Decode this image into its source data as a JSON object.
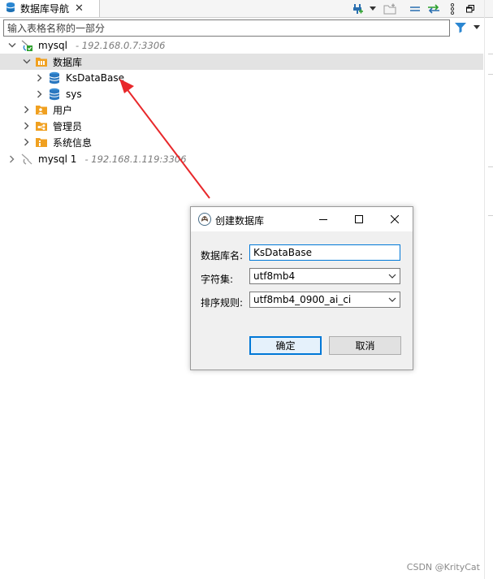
{
  "tab": {
    "title": "数据库导航"
  },
  "filter": {
    "placeholder": "输入表格名称的一部分"
  },
  "tree": {
    "conn1": {
      "name": "mysql",
      "host": "- 192.168.0.7:3306"
    },
    "databases": {
      "label": "数据库"
    },
    "db1": {
      "label": "KsDataBase"
    },
    "db2": {
      "label": "sys"
    },
    "users": {
      "label": "用户"
    },
    "admins": {
      "label": "管理员"
    },
    "sysinfo": {
      "label": "系统信息"
    },
    "conn2": {
      "name": "mysql 1",
      "host": "- 192.168.1.119:3306"
    }
  },
  "dialog": {
    "title": "创建数据库",
    "name_label": "数据库名:",
    "name_value": "KsDataBase",
    "charset_label": "字符集:",
    "charset_value": "utf8mb4",
    "collation_label": "排序规则:",
    "collation_value": "utf8mb4_0900_ai_ci",
    "ok_label": "确定",
    "cancel_label": "取消"
  },
  "watermark": "CSDN @KrityCat",
  "colors": {
    "accent": "#0078d7",
    "arrow": "#e8282b",
    "selection": "#e3e3e3"
  }
}
